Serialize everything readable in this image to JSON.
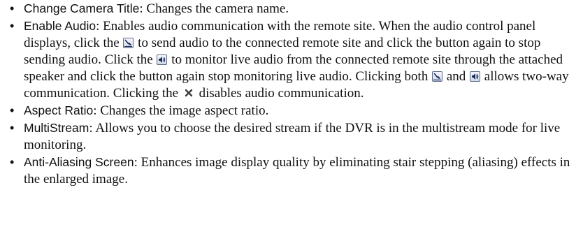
{
  "items": [
    {
      "term": "Change Camera Title",
      "desc": ": Changes the camera name."
    },
    {
      "term": "Enable Audio",
      "parts": [
        ": Enables audio communication with the remote site.  When the audio control panel displays, click the ",
        " to send audio to the connected remote site and click the button again to stop sending audio.  Click the ",
        " to monitor live audio from the connected remote site through the attached speaker and click the button again stop monitoring live audio.  Clicking both ",
        " and ",
        " allows two-way communication.  Clicking the ",
        " disables audio communication."
      ]
    },
    {
      "term": "Aspect Ratio",
      "desc": ": Changes the image aspect ratio."
    },
    {
      "term": "MultiStream",
      "desc": ": Allows you to choose the desired stream if the DVR is in the multistream mode for live monitoring."
    },
    {
      "term": "Anti-Aliasing Screen",
      "desc": ": Enhances image display quality by eliminating stair stepping (aliasing) effects in the enlarged image."
    }
  ],
  "icons": {
    "mic": "microphone-icon",
    "speaker": "speaker-icon",
    "close": "close-icon"
  }
}
